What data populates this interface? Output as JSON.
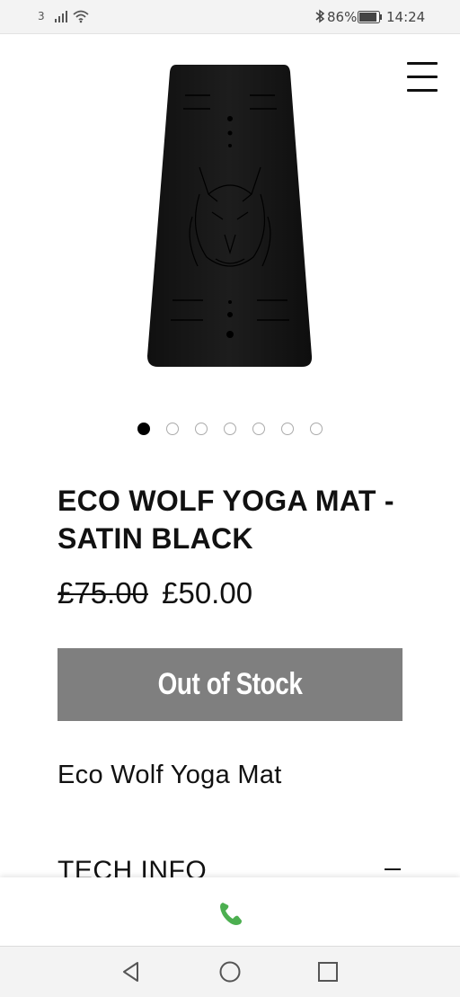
{
  "status_bar": {
    "carrier": "3",
    "battery_percent": "86%",
    "time": "14:24"
  },
  "header": {
    "menu_icon": "hamburger-menu-icon"
  },
  "product": {
    "image_icon": "wolf-yoga-mat-image",
    "carousel": {
      "count": 7,
      "active_index": 0
    },
    "title": "ECO WOLF YOGA MAT - SATIN BLACK",
    "price_original": "£75.00",
    "price_sale": "£50.00",
    "stock_button_label": "Out of Stock",
    "description": "Eco Wolf Yoga Mat",
    "tech_info_label": "TECH INFO"
  },
  "contact_bar": {
    "icon": "phone-icon",
    "accent_color": "#4caf50"
  },
  "nav_bar": {
    "back_icon": "back-triangle-icon",
    "home_icon": "home-circle-icon",
    "recents_icon": "recents-square-icon"
  }
}
